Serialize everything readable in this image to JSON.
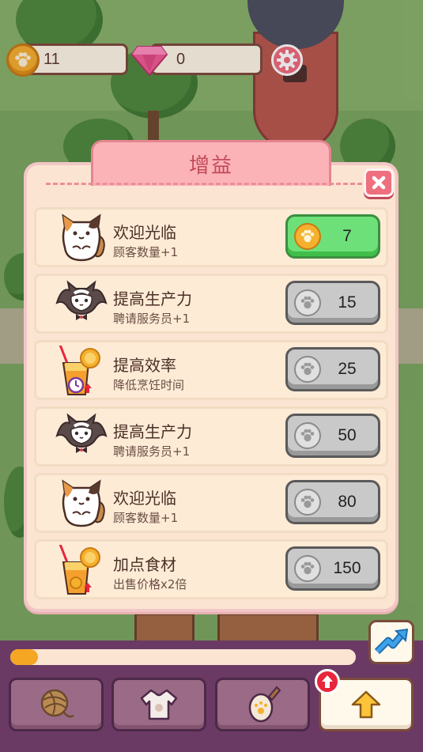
{
  "hud": {
    "coins": "11",
    "gems": "0",
    "coin_icon": "paw-coin-icon",
    "gem_icon": "gem-icon",
    "settings_icon": "gear-icon"
  },
  "dialog": {
    "title": "增益",
    "close_icon": "close-icon",
    "items": [
      {
        "title": "欢迎光临",
        "subtitle": "顾客数量+1",
        "price": "7",
        "icon": "calico-cat-icon",
        "state": "affordable"
      },
      {
        "title": "提高生产力",
        "subtitle": "聘请服务员+1",
        "price": "15",
        "icon": "tuxedo-cat-icon",
        "state": "locked"
      },
      {
        "title": "提高效率",
        "subtitle": "降低烹饪时间",
        "price": "25",
        "icon": "juice-clock-icon",
        "state": "locked"
      },
      {
        "title": "提高生产力",
        "subtitle": "聘请服务员+1",
        "price": "50",
        "icon": "tuxedo-cat-icon",
        "state": "locked"
      },
      {
        "title": "欢迎光临",
        "subtitle": "顾客数量+1",
        "price": "80",
        "icon": "calico-cat-icon",
        "state": "locked"
      },
      {
        "title": "加点食材",
        "subtitle": "出售价格x2倍",
        "price": "150",
        "icon": "juice-upgrade-icon",
        "state": "locked"
      }
    ]
  },
  "bottom": {
    "progress_fraction": 0.08,
    "buttons": [
      "yarn-ball-icon",
      "shirt-icon",
      "egg-decor-icon",
      "upgrade-arrow-icon"
    ],
    "trend_icon": "trend-arrow-icon"
  },
  "colors": {
    "accent_green": "#6ee07a",
    "locked_gray": "#c9c9c9",
    "panel_bg": "#fbe5d2",
    "title_pink": "#fbb3b8",
    "bar_purple": "#6a3a64"
  }
}
